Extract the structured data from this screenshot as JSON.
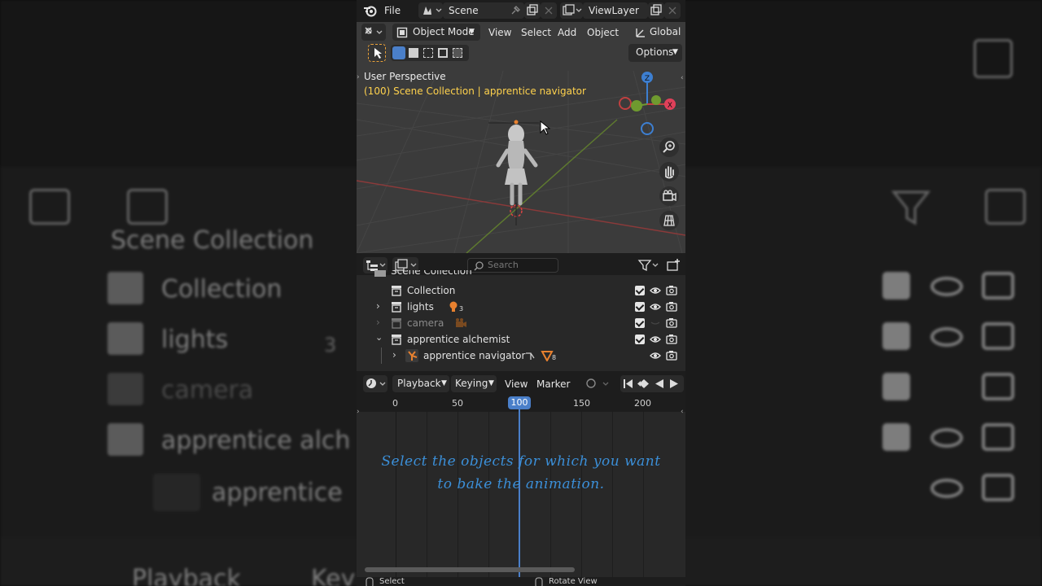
{
  "topbar": {
    "file_label": "File",
    "scene_name": "Scene",
    "view_layer": "ViewLayer"
  },
  "viewport": {
    "mode_label": "Object Mode",
    "menus": [
      "View",
      "Select",
      "Add",
      "Object"
    ],
    "orientation": "Global",
    "options_label": "Options",
    "perspective_label": "User Perspective",
    "selection_info": "(100) Scene Collection | apprentice navigator",
    "gizmo_axes": {
      "z": "Z",
      "x": "X"
    }
  },
  "outliner": {
    "search_placeholder": "Search",
    "top_partial": "Scene Collection",
    "rows": [
      {
        "label": "Collection"
      },
      {
        "label": "lights",
        "count": "3"
      },
      {
        "label": "camera"
      },
      {
        "label": "apprentice alchemist"
      },
      {
        "label": "apprentice navigator",
        "count": "8"
      }
    ]
  },
  "timeline": {
    "menus": {
      "playback": "Playback",
      "keying": "Keying",
      "view": "View",
      "marker": "Marker"
    },
    "ruler_ticks": [
      "0",
      "50",
      "100",
      "150",
      "200"
    ],
    "current_frame": "100",
    "caption_line1": "Select the objects for which you want",
    "caption_line2": "to bake the animation."
  },
  "status": {
    "left": "Select",
    "right": "Rotate View"
  },
  "background": {
    "rows": [
      "Scene Collection",
      "Collection",
      "lights",
      "camera",
      "apprentice alch",
      "apprentice"
    ],
    "count_lights": "3",
    "playback": "Playback",
    "keying": "Key"
  },
  "colors": {
    "accent_blue": "#4a7fc9",
    "info_yellow": "#ffd24d",
    "caption_blue": "#3b8fd8",
    "orange": "#e8812f"
  }
}
